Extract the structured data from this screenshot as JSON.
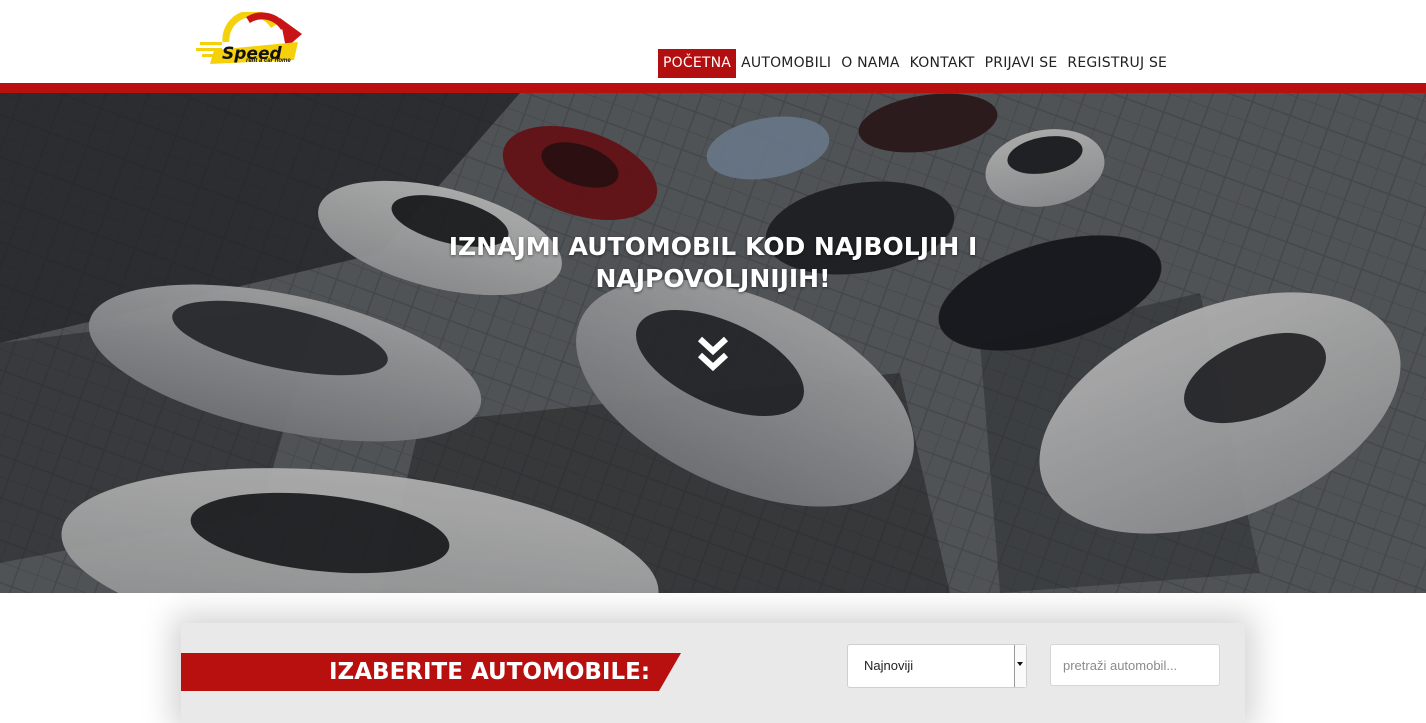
{
  "brand": {
    "logo_name": "Speed",
    "tagline": "rent a car home",
    "colors": {
      "red": "#b80f0f",
      "yellow": "#f5d10c",
      "dark": "#111111"
    }
  },
  "nav": {
    "items": [
      {
        "label": "POČETNA",
        "active": true
      },
      {
        "label": "AUTOMOBILI",
        "active": false
      },
      {
        "label": "O NAMA",
        "active": false
      },
      {
        "label": "KONTAKT",
        "active": false
      },
      {
        "label": "PRIJAVI SE",
        "active": false
      },
      {
        "label": "REGISTRUJ SE",
        "active": false
      }
    ]
  },
  "hero": {
    "title_line1": "IZNAJMI AUTOMOBIL KOD NAJBOLJIH I",
    "title_line2": "NAJPOVOLJNIJIH!",
    "scroll_icon": "double-chevron-down-icon"
  },
  "filter": {
    "title": "IZABERITE AUTOMOBILE:",
    "sort_selected": "Najnoviji",
    "search_placeholder": "pretraži automobil..."
  }
}
